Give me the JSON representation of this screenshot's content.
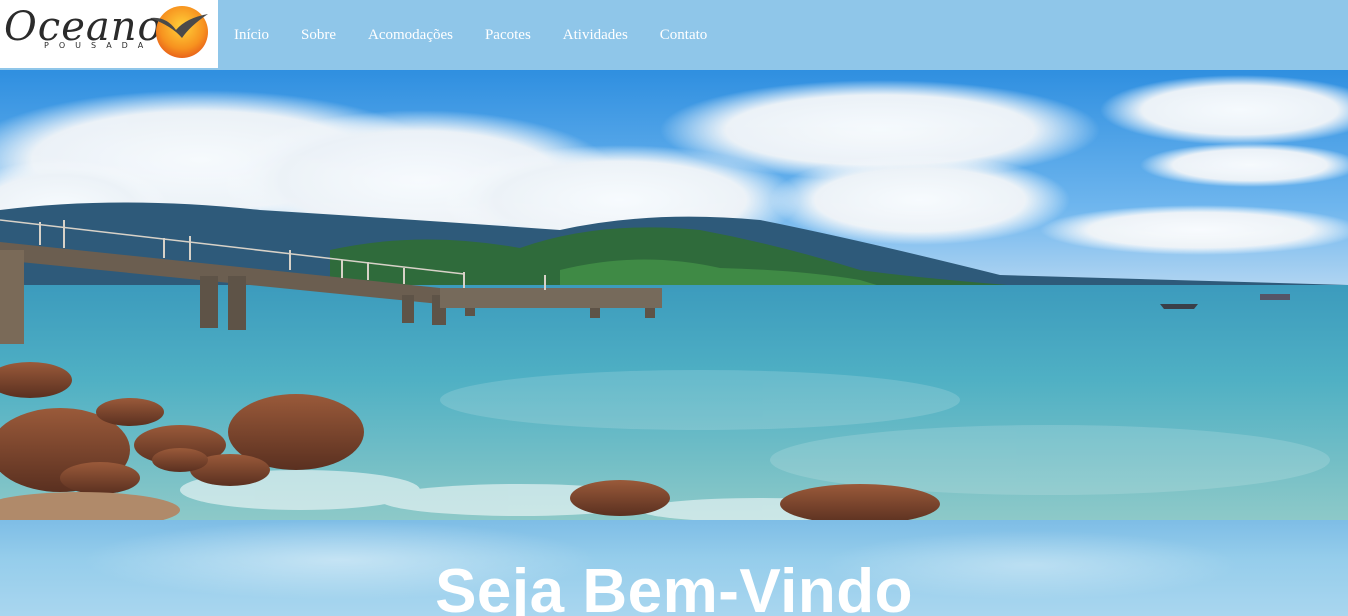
{
  "brand": {
    "name": "Oceano",
    "subtitle": "POUSADA"
  },
  "nav": {
    "items": [
      {
        "label": "Início"
      },
      {
        "label": "Sobre"
      },
      {
        "label": "Acomodações"
      },
      {
        "label": "Pacotes"
      },
      {
        "label": "Atividades"
      },
      {
        "label": "Contato"
      }
    ]
  },
  "hero": {
    "image": "beach-pier-photo"
  },
  "welcome": {
    "heading": "Seja Bem-Vindo"
  },
  "colors": {
    "header_bg": "#8fc6e9",
    "nav_text": "#ffffff",
    "logo_bg": "#ffffff",
    "sun_orange": "#f28a1e"
  }
}
